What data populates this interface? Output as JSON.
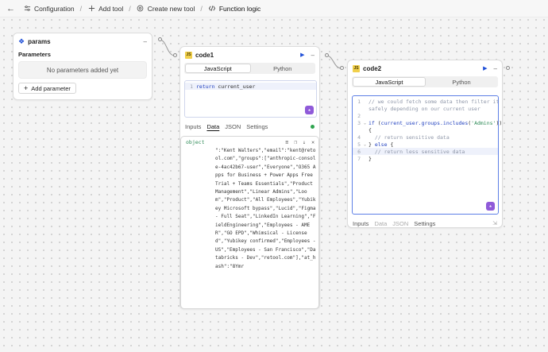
{
  "breadcrumb": {
    "items": [
      {
        "label": "Configuration",
        "icon": "sliders-icon"
      },
      {
        "label": "Add tool",
        "icon": "plus-icon"
      },
      {
        "label": "Create new tool",
        "icon": "settings-circle-icon"
      },
      {
        "label": "Function logic",
        "icon": "code-slash-icon"
      }
    ]
  },
  "params": {
    "title": "params",
    "section_label": "Parameters",
    "empty_text": "No parameters added yet",
    "add_label": "Add parameter"
  },
  "code1": {
    "title": "code1",
    "badge": "JS",
    "lang_tabs": [
      "JavaScript",
      "Python"
    ],
    "active_lang": "JavaScript",
    "lines": [
      {
        "n": "1",
        "text": "return current_user"
      }
    ],
    "bottom_tabs": [
      "Inputs",
      "Data",
      "JSON",
      "Settings"
    ],
    "active_bottom_tab": "Data",
    "output": {
      "type_label": "object",
      "text": "\":\"Kent Walters\",\"email\":\"kent@retool.com\",\"groups\":[\"anthropic-console-4ac42b67-user\",\"Everyone\",\"O365 Apps for Business + Power Apps Free Trial + Teams Essentials\",\"Product Management\",\"Linear Admins\",\"Loom\",\"Product\",\"All Employees\",\"Yubikey Microsoft bypass\",\"Lucid\",\"Figma - Full Seat\",\"LinkedIn Learning\",\"FieldEngineering\",\"Employees - AMER\",\"GO EPD\",\"Whimsical - Licensed\",\"Yubikey confirmed\",\"Employees - US\",\"Employees - San Francisco\",\"Databricks - Dev\",\"retool.com\"],\"at_hash\":\"8Ymr"
    }
  },
  "code2": {
    "title": "code2",
    "badge": "JS",
    "lang_tabs": [
      "JavaScript",
      "Python"
    ],
    "active_lang": "JavaScript",
    "lines": [
      {
        "n": "1",
        "fold": "",
        "text": "// we could fetch some data then filter it",
        "kind": "comment"
      },
      {
        "n": "",
        "fold": "",
        "text": "safely depending on our current user",
        "kind": "comment"
      },
      {
        "n": "2",
        "fold": "",
        "text": "",
        "kind": "plain"
      },
      {
        "n": "3",
        "fold": "v",
        "text": "if (current_user.groups.includes('Admins'))",
        "kind": "if"
      },
      {
        "n": "",
        "fold": "",
        "text": "{",
        "kind": "plain"
      },
      {
        "n": "4",
        "fold": "",
        "text": "  // return sensitive data",
        "kind": "comment"
      },
      {
        "n": "5",
        "fold": "v",
        "text": "} else {",
        "kind": "else"
      },
      {
        "n": "6",
        "fold": "",
        "text": "  // return less sensitive data",
        "kind": "comment"
      },
      {
        "n": "7",
        "fold": "",
        "text": "}",
        "kind": "plain"
      }
    ],
    "bottom_tabs": [
      "Inputs",
      "Data",
      "JSON",
      "Settings"
    ],
    "active_bottom_tab": "Settings"
  },
  "colors": {
    "accent": "#1f4fd8",
    "ai_button": "#8f5ad9",
    "success": "#2ea44f",
    "js_badge": "#f1d04b"
  }
}
